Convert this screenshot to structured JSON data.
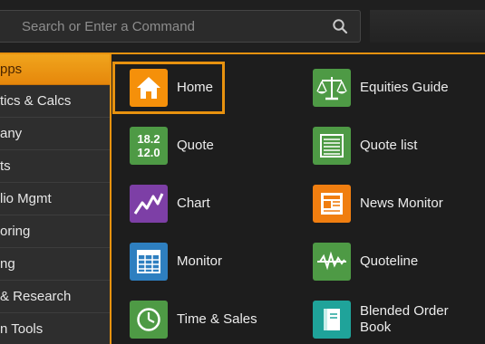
{
  "search": {
    "placeholder": "Search or Enter a Command"
  },
  "sidebar": {
    "items": [
      {
        "label": "pps",
        "active": true
      },
      {
        "label": "tics & Calcs"
      },
      {
        "label": "any"
      },
      {
        "label": "ts"
      },
      {
        "label": "lio Mgmt"
      },
      {
        "label": "oring"
      },
      {
        "label": "ng"
      },
      {
        "label": "& Research"
      },
      {
        "label": "n Tools"
      }
    ]
  },
  "apps": {
    "home": {
      "label": "Home",
      "icon": "home-icon",
      "color": "#f5900a"
    },
    "equities_guide": {
      "label": "Equities Guide",
      "icon": "scales-icon",
      "color": "#4e9a45"
    },
    "quote": {
      "label": "Quote",
      "icon": "quote-icon",
      "color": "#4e9a45",
      "tile_line1": "18.2",
      "tile_line2": "12.0"
    },
    "quote_list": {
      "label": "Quote list",
      "icon": "list-icon",
      "color": "#4e9a45"
    },
    "chart": {
      "label": "Chart",
      "icon": "chart-icon",
      "color": "#7d3fa6"
    },
    "news_monitor": {
      "label": "News Monitor",
      "icon": "newspaper-icon",
      "color": "#f07e10"
    },
    "monitor": {
      "label": "Monitor",
      "icon": "table-icon",
      "color": "#2e7fc0"
    },
    "quoteline": {
      "label": "Quoteline",
      "icon": "ticker-line-icon",
      "color": "#4e9a45"
    },
    "time_sales": {
      "label": "Time & Sales",
      "icon": "clock-icon",
      "color": "#4e9a45"
    },
    "blended_order_book": {
      "label": "Blended Order Book",
      "label_line1": "Blended Order",
      "label_line2": "Book",
      "icon": "book-icon",
      "color": "#1fa39a"
    }
  }
}
